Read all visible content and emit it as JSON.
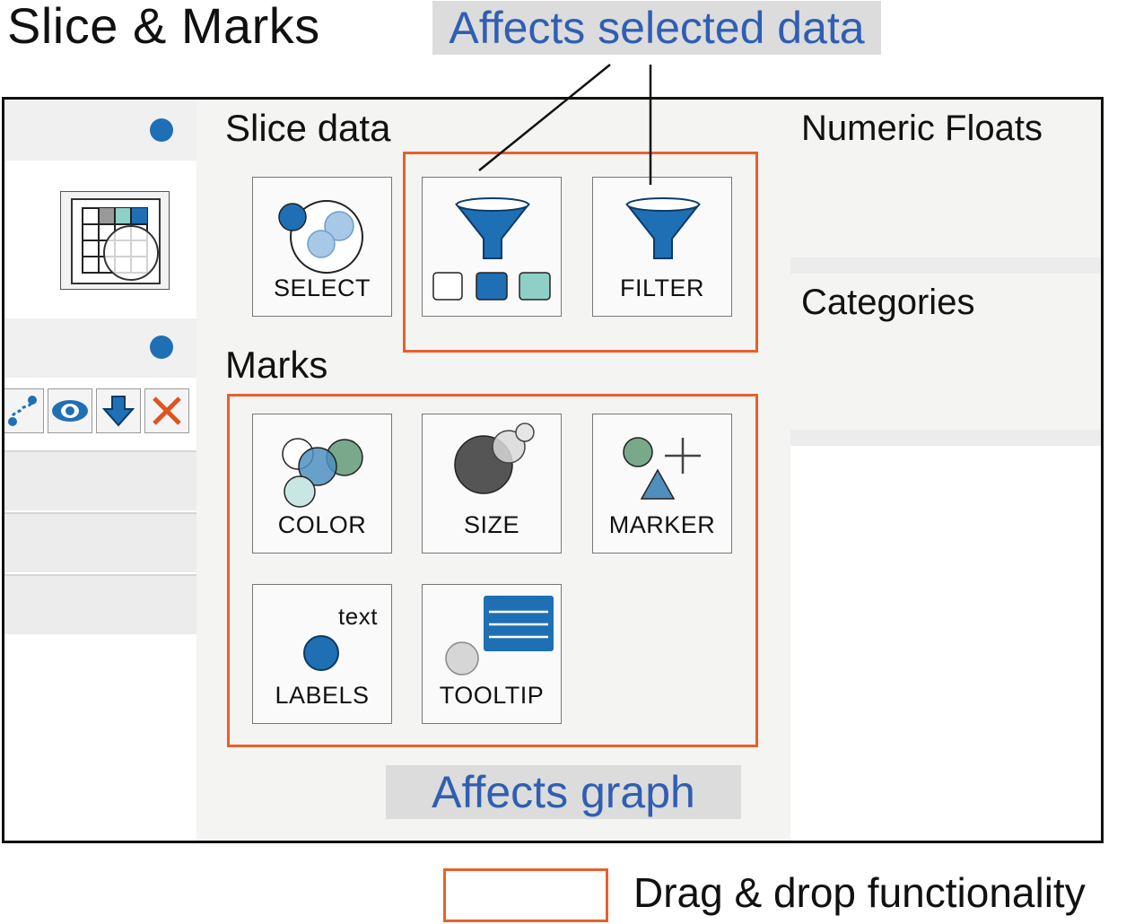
{
  "title": "Slice & Marks",
  "callouts": {
    "top": "Affects selected data",
    "bottom": "Affects graph"
  },
  "slice_section": {
    "title": "Slice data",
    "tiles": [
      {
        "label": "SELECT",
        "icon": "select-circles-icon"
      },
      {
        "label": "",
        "icon": "funnel-categories-icon"
      },
      {
        "label": "FILTER",
        "icon": "funnel-icon"
      }
    ]
  },
  "marks_section": {
    "title": "Marks",
    "tiles": [
      {
        "label": "COLOR",
        "icon": "color-circles-icon"
      },
      {
        "label": "SIZE",
        "icon": "size-circles-icon"
      },
      {
        "label": "MARKER",
        "icon": "marker-shapes-icon"
      },
      {
        "label": "LABELS",
        "icon": "label-text-icon",
        "sample_text": "text"
      },
      {
        "label": "TOOLTIP",
        "icon": "tooltip-icon"
      }
    ]
  },
  "right_panel": {
    "numeric_title": "Numeric Floats",
    "categories_title": "Categories"
  },
  "left_panel": {
    "toolbar_icons": [
      "link-icon",
      "eye-icon",
      "download-arrow-icon",
      "close-x-icon"
    ]
  },
  "legend": {
    "label": "Drag & drop functionality"
  },
  "colors": {
    "accent_blue": "#1f6fb5",
    "drag_border": "#e8602c",
    "callout_text": "#2f5fb3",
    "teal": "#8fd0c6",
    "green": "#77a98a"
  }
}
